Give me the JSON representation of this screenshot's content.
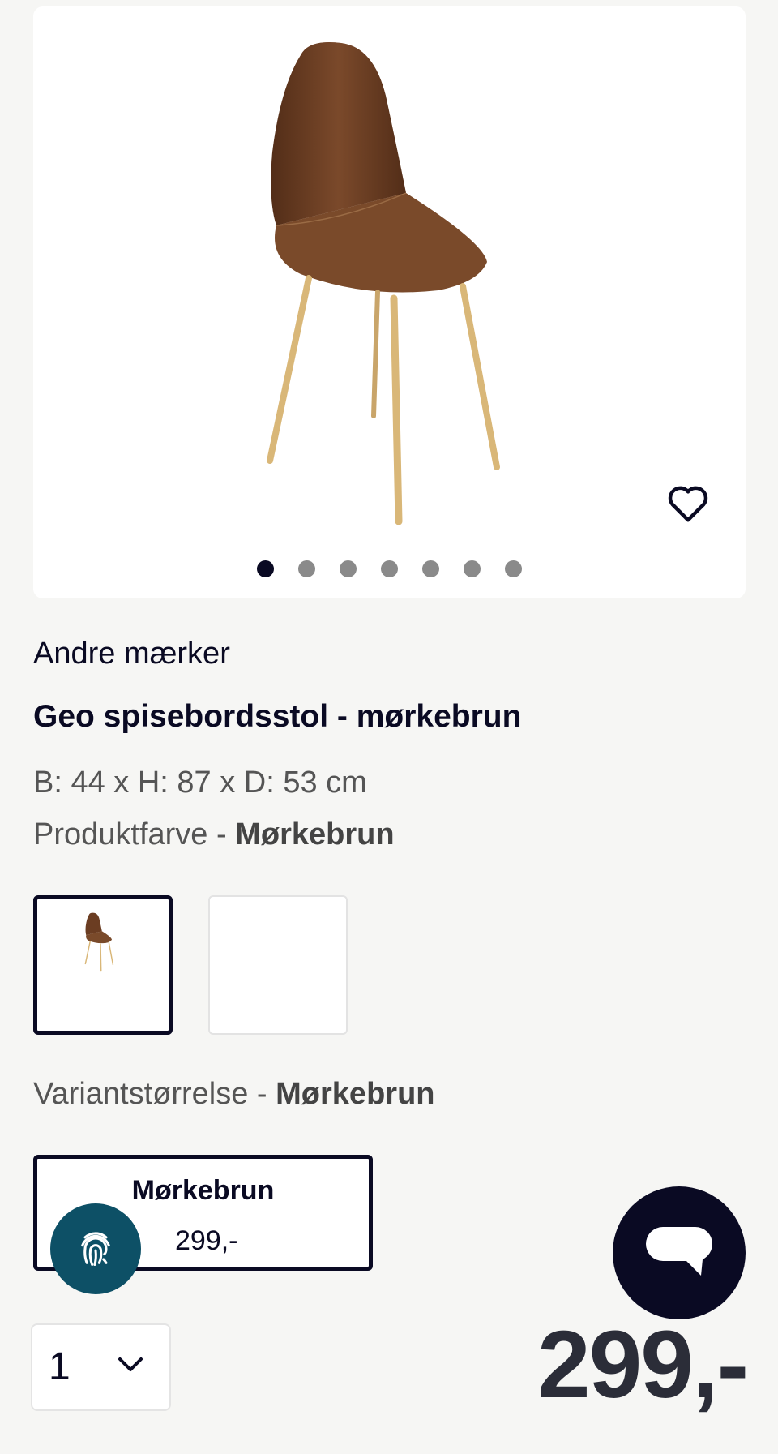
{
  "gallery": {
    "image_alt": "Geo spisebordsstol - mørkebrun",
    "favorite_icon": "heart-outline-icon",
    "slide_count": 7,
    "active_slide": 1
  },
  "product": {
    "brand": "Andre mærker",
    "title": "Geo spisebordsstol - mørkebrun",
    "dimensions": "B: 44 x H: 87 x D: 53 cm",
    "color_label": "Produktfarve - ",
    "color_value": "Mørkebrun"
  },
  "swatches": [
    {
      "name": "Mørkebrun",
      "selected": true
    },
    {
      "name": "",
      "selected": false
    }
  ],
  "variant": {
    "label": "Variantstørrelse - ",
    "value": "Mørkebrun",
    "option_name": "Mørkebrun",
    "option_price": "299,-"
  },
  "purchase": {
    "quantity": "1",
    "price": "299,-"
  },
  "colors": {
    "navy": "#0a0a23",
    "chair_brown": "#6b3d22",
    "leg_wood": "#d9b778",
    "fingerprint_bg": "#0d5066"
  },
  "icons": {
    "fingerprint": "fingerprint-icon",
    "chat": "chat-bubble-icon",
    "chevron": "chevron-down-icon"
  }
}
